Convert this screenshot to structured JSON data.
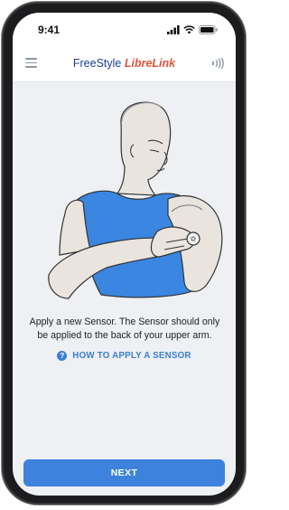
{
  "status_bar": {
    "time": "9:41",
    "icons": [
      "signal-icon",
      "wifi-icon",
      "battery-icon"
    ]
  },
  "appbar": {
    "menu_icon": "hamburger-menu-icon",
    "logo_part1": "FreeStyle",
    "logo_part2": "LibreLink",
    "nfc_icon": "nfc-scan-icon"
  },
  "illustration": {
    "subject": "man applying sensor to back of upper arm"
  },
  "content": {
    "instruction": "Apply a new Sensor. The Sensor should only be applied to the back of your upper arm.",
    "help_link_icon": "question-circle-icon",
    "help_link": "HOW TO APPLY A SENSOR"
  },
  "footer": {
    "next_label": "NEXT"
  },
  "colors": {
    "accent": "#3d82dc",
    "link": "#3b7fd4",
    "logo_blue": "#1e3f8f",
    "logo_orange": "#e0533a",
    "shirt": "#3a86e0",
    "background": "#eef0f3"
  }
}
